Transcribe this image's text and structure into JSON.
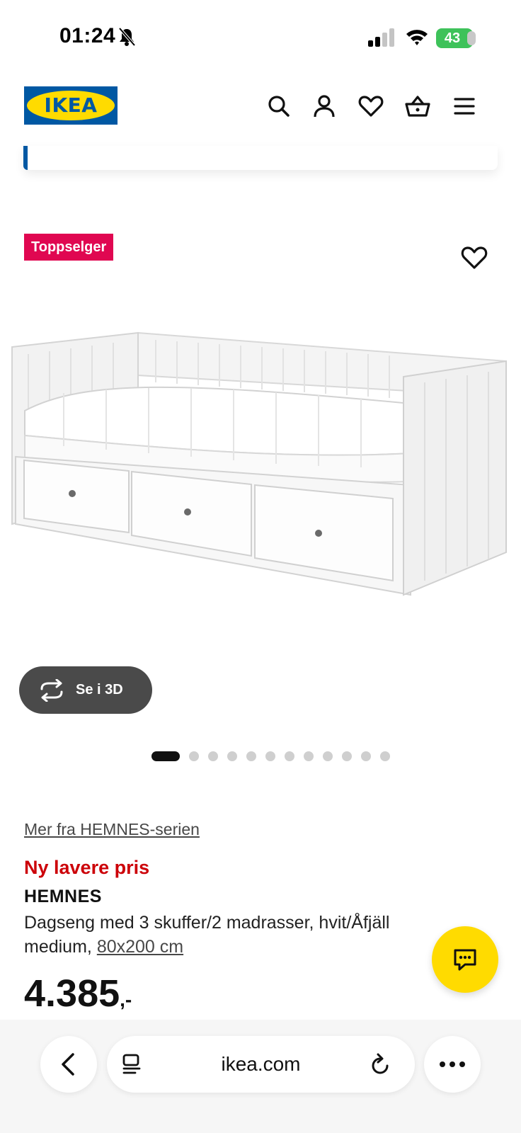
{
  "status_bar": {
    "time": "01:24",
    "battery": "43"
  },
  "header": {
    "logo_text": "IKEA",
    "icons": [
      "search-icon",
      "account-icon",
      "wishlist-icon",
      "cart-icon",
      "menu-icon"
    ]
  },
  "product": {
    "badge": "Toppselger",
    "three_d_label": "Se i 3D",
    "carousel": {
      "total_images": 12,
      "active_index": 0
    },
    "series_link": "Mer fra HEMNES-serien",
    "price_note": "Ny lavere pris",
    "name": "HEMNES",
    "description": "Dagseng med 3 skuffer/2 madrasser, hvit/Åfjäll medium, ",
    "size_link": "80x200 cm",
    "price": "4.385",
    "price_suffix": ",-"
  },
  "browser": {
    "url": "ikea.com"
  },
  "colors": {
    "ikea_blue": "#0058a3",
    "ikea_yellow": "#ffdb00",
    "badge_red": "#e00751",
    "price_note_red": "#cc0008",
    "battery_green": "#3ec25a"
  }
}
